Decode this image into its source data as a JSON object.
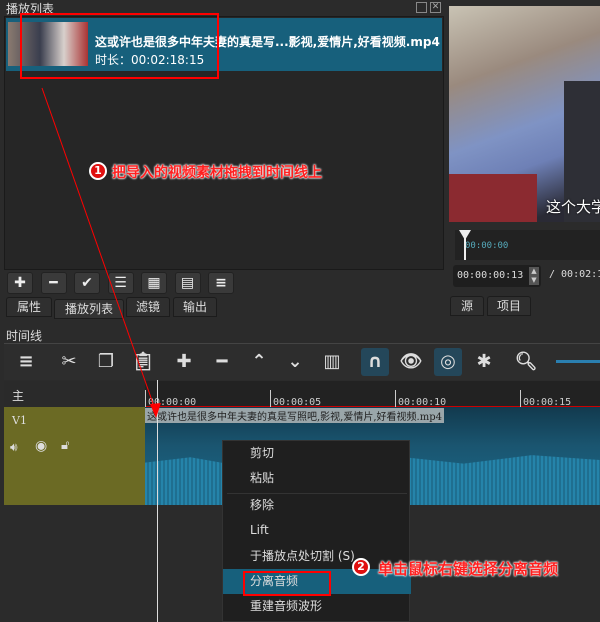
{
  "playlist": {
    "title": "播放列表",
    "item": {
      "name": "这或许也是很多中年夫妻的真是写...影视,爱情片,好看视频.mp4",
      "duration": "时长：00:02:18:15"
    },
    "toolbar": [
      {
        "icon": "add-icon",
        "glyph": "✚"
      },
      {
        "icon": "remove-icon",
        "glyph": "━"
      },
      {
        "icon": "check-icon",
        "glyph": "✔"
      },
      {
        "icon": "list-view-icon",
        "glyph": "☰"
      },
      {
        "icon": "grid-view-icon",
        "glyph": "▦"
      },
      {
        "icon": "detail-view-icon",
        "glyph": "▤"
      },
      {
        "icon": "menu-icon",
        "glyph": "≡"
      }
    ]
  },
  "left_tabs": [
    "属性",
    "播放列表",
    "滤镜",
    "输出"
  ],
  "preview": {
    "subtitle": "这个大学",
    "ruler_start": "00:00:00",
    "timecode": "00:00:00:13",
    "total": "/ 00:02:1",
    "tabs": [
      "源",
      "项目"
    ]
  },
  "timeline": {
    "title": "时间线",
    "master": "主",
    "track": "V1",
    "ticks": [
      "00:00:00",
      "00:00:05",
      "00:00:10",
      "00:00:15"
    ],
    "clip_name": "这或许也是很多中年夫妻的真是写照吧,影视,爱情片,好看视频.mp4"
  },
  "context_menu": [
    "剪切",
    "粘贴",
    "移除",
    "Lift",
    "于播放点处切割 (S)",
    "分离音频",
    "重建音频波形"
  ],
  "annotations": {
    "step1_num": "1",
    "step1": "把导入的视频素材拖拽到时间线上",
    "step2_num": "2",
    "step2": "单击鼠标右键选择分离音频"
  },
  "colors": {
    "selection": "#17607c",
    "track_header": "#6b6a24",
    "annotation": "#ff2020"
  }
}
